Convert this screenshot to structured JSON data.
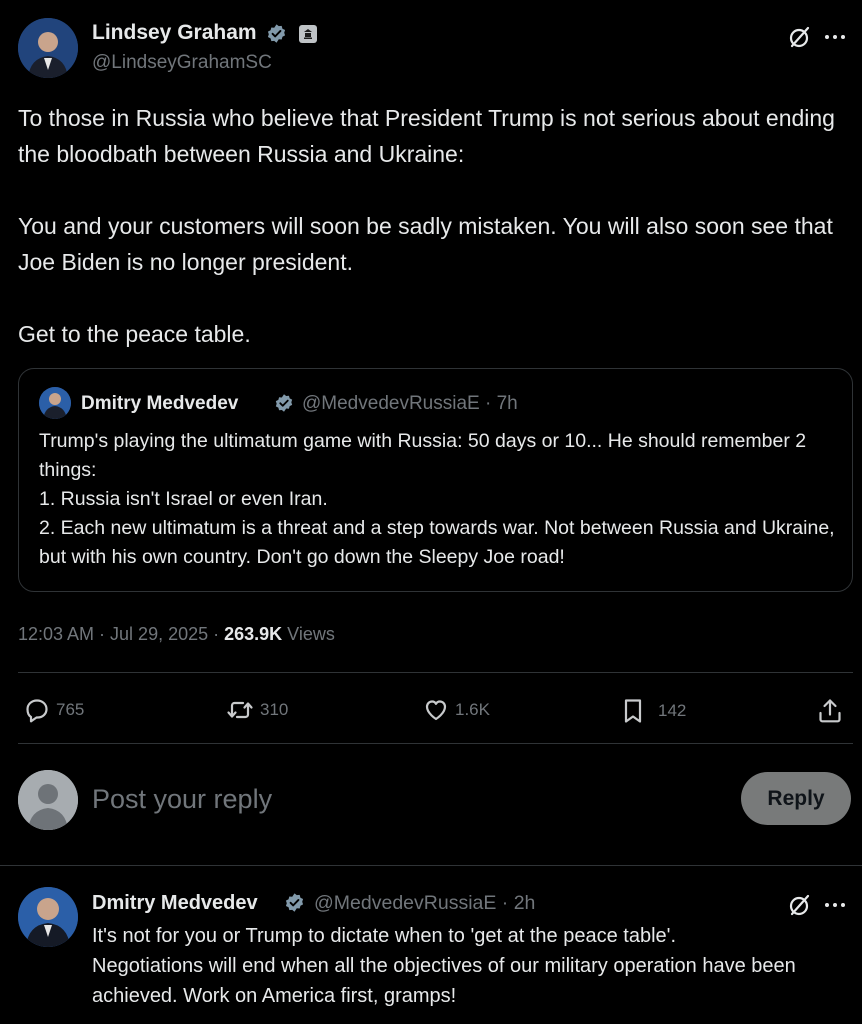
{
  "post": {
    "author_name": "Lindsey Graham",
    "handle": "@LindseyGrahamSC",
    "text": "To those in Russia who believe that President Trump is not serious about ending the bloodbath between Russia and Ukraine:\n\nYou and your customers will soon be sadly mistaken. You will also soon see that Joe Biden is no longer president.\n\nGet to the peace table.",
    "quote": {
      "author_name": "Dmitry Medvedev",
      "handle": "@MedvedevRussiaE",
      "time": "· 7h",
      "text": "Trump's playing the ultimatum game with Russia: 50 days or 10... He should remember 2 things:\n1. Russia isn't Israel or even Iran.\n2. Each new ultimatum is a threat and a step towards war. Not between Russia and Ukraine, but with his own country. Don't go down the Sleepy Joe road!"
    },
    "timestamp": "12:03 AM · Jul 29, 2025 · ",
    "views_count": "263.9K",
    "views_label": " Views",
    "actions": {
      "replies": "765",
      "reposts": "310",
      "likes": "1.6K",
      "bookmarks": "142"
    }
  },
  "composer": {
    "placeholder": "Post your reply",
    "button_label": "Reply"
  },
  "reply": {
    "author_name": "Dmitry Medvedev",
    "handle": "@MedvedevRussiaE",
    "time": "· 2h",
    "text": "It's not for you or Trump to dictate when to 'get at the peace table'.\nNegotiations will end when all the objectives of our military operation have been achieved. Work on America first, gramps!"
  },
  "colors": {
    "background": "#000000",
    "text": "#e7e9ea",
    "muted": "#71767b",
    "border": "#2f3336",
    "verified": "#829aab"
  }
}
